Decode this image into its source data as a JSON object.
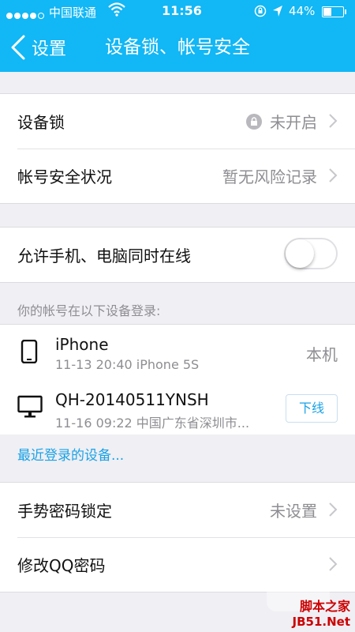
{
  "status_bar": {
    "carrier": "中国联通",
    "time": "11:56",
    "battery": "44%",
    "battery_level": 0.44
  },
  "nav": {
    "back_label": "设置",
    "title": "设备锁、帐号安全"
  },
  "security": {
    "device_lock": {
      "label": "设备锁",
      "value": "未开启"
    },
    "account_status": {
      "label": "帐号安全状况",
      "value": "暂无风险记录"
    }
  },
  "online": {
    "label": "允许手机、电脑同时在线",
    "enabled": false
  },
  "devices": {
    "section_label": "你的帐号在以下设备登录:",
    "items": [
      {
        "name": "iPhone",
        "info": "11-13 20:40  iPhone 5S",
        "badge": "本机"
      },
      {
        "name": "QH-20140511YNSH",
        "info": "11-16 09:22  中国广东省深圳市...",
        "action": "下线"
      }
    ],
    "recent_link": "最近登录的设备..."
  },
  "more": {
    "gesture": {
      "label": "手势密码锁定",
      "value": "未设置"
    },
    "change_password": {
      "label": "修改QQ密码"
    }
  },
  "watermark": {
    "line1": "脚本之家",
    "line2": "JB51.Net"
  },
  "colors": {
    "header": "#12b7f5",
    "link": "#1aa2e5",
    "background": "#efeff4"
  }
}
